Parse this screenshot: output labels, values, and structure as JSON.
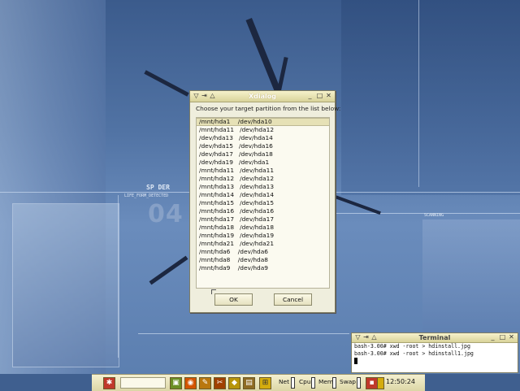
{
  "xdialog": {
    "title": "Xdialog",
    "prompt": "Choose your target partition from the list below:",
    "items": [
      "/mnt/hda1    /dev/hda10",
      "/mnt/hda11   /dev/hda12",
      "/dev/hda13   /dev/hda14",
      "/dev/hda15   /dev/hda16",
      "/dev/hda17   /dev/hda18",
      "/dev/hda19   /dev/hda1",
      "/mnt/hda11   /dev/hda11",
      "/mnt/hda12   /dev/hda12",
      "/mnt/hda13   /dev/hda13",
      "/mnt/hda14   /dev/hda14",
      "/mnt/hda15   /dev/hda15",
      "/mnt/hda16   /dev/hda16",
      "/mnt/hda17   /dev/hda17",
      "/mnt/hda18   /dev/hda18",
      "/mnt/hda19   /dev/hda19",
      "/mnt/hda21   /dev/hda21",
      "/mnt/hda6    /dev/hda6",
      "/mnt/hda8    /dev/hda8",
      "/mnt/hda9    /dev/hda9"
    ],
    "ok_label": "OK",
    "cancel_label": "Cancel"
  },
  "terminal": {
    "title": "Terminal",
    "lines": [
      "bash-3.00# xwd -root > hdinstall.jpg",
      "bash-3.00# xwd -root > hdinstall1.jpg"
    ]
  },
  "taskbar": {
    "labels": {
      "net": "Net",
      "cpu": "Cpu",
      "mem": "Mem",
      "swap": "Swap"
    },
    "clock": "12:50:24"
  },
  "wallpaper": {
    "logo_text": "SP   DER",
    "sub_text": "LIFE_FORM_DETECTED",
    "big_number": "04",
    "side_text": "SCANNING"
  },
  "colors": {
    "window_bg": "#efeedd",
    "titlebar": "#d9d39a",
    "desktop": "#5173a4"
  }
}
